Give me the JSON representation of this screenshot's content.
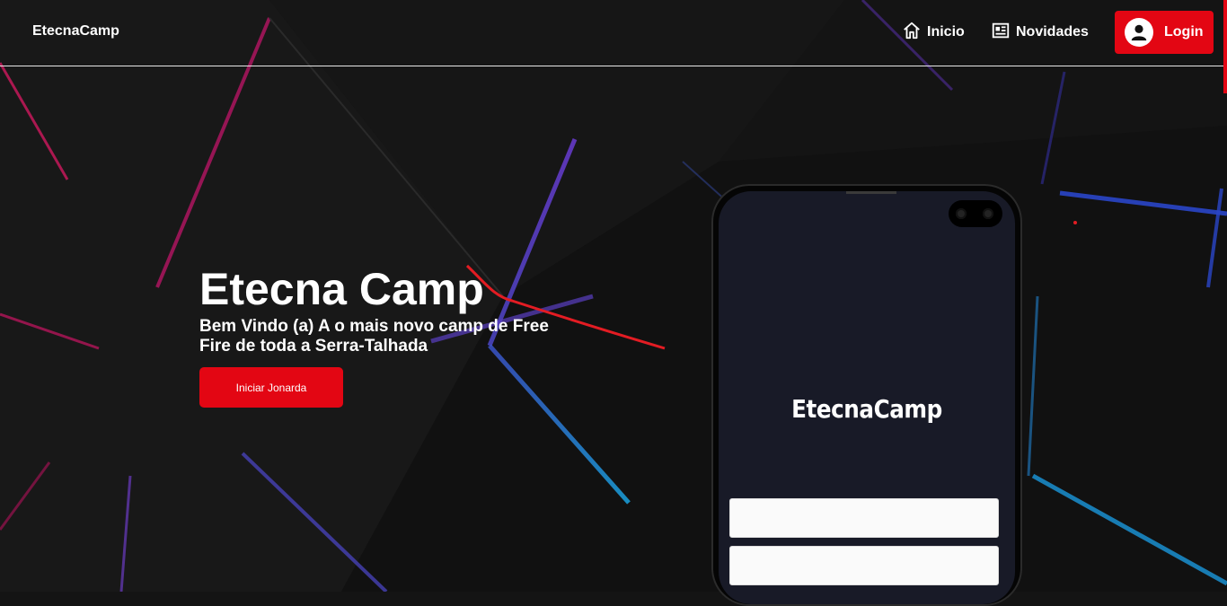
{
  "nav": {
    "brand": "EtecnaCamp",
    "links": [
      {
        "label": "Inicio",
        "icon": "home-icon"
      },
      {
        "label": "Novidades",
        "icon": "newspaper-icon"
      }
    ],
    "login_label": "Login"
  },
  "hero": {
    "title": "Etecna Camp",
    "subtitle": "Bem Vindo (a) A o mais novo camp de Free Fire de toda a Serra-Talhada",
    "cta_label": "Iniciar Jonarda"
  },
  "phone": {
    "brand": "EtecnaCamp",
    "field1_value": "",
    "field2_value": ""
  },
  "colors": {
    "background": "#141414",
    "accent": "#e30613",
    "phone_screen": "#181a27"
  }
}
